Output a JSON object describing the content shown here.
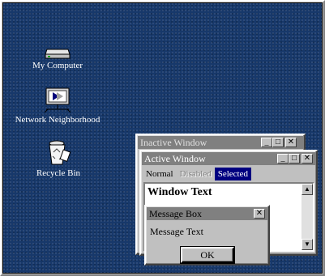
{
  "desktop": {
    "background_color": "#17386a",
    "icons": [
      {
        "label": "My Computer",
        "icon": "computer-icon"
      },
      {
        "label": "Network Neighborhood",
        "icon": "network-icon"
      },
      {
        "label": "Recycle Bin",
        "icon": "recycle-bin-icon"
      }
    ]
  },
  "inactive_window": {
    "title": "Inactive Window",
    "title_color": "#808080",
    "buttons": {
      "minimize": "_",
      "maximize": "□",
      "close": "✕"
    }
  },
  "active_window": {
    "title": "Active Window",
    "title_color": "#808080",
    "menu": {
      "normal": "Normal",
      "disabled": "Disabled",
      "selected": "Selected"
    },
    "selected_color": "#000080",
    "window_text": "Window Text",
    "buttons": {
      "minimize": "_",
      "maximize": "□",
      "close": "✕"
    }
  },
  "message_box": {
    "title": "Message Box",
    "text": "Message Text",
    "ok_label": "OK",
    "close": "✕"
  }
}
